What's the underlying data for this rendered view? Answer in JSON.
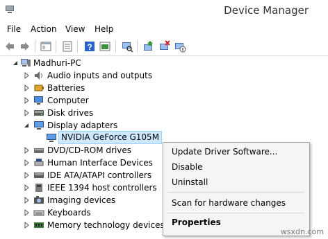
{
  "window": {
    "title": "Device Manager"
  },
  "menubar": {
    "items": [
      "File",
      "Action",
      "View",
      "Help"
    ]
  },
  "toolbar": {
    "buttons": [
      "back-icon",
      "forward-icon",
      "properties-pane-icon",
      "update-icon",
      "help-icon",
      "show-hidden-icon",
      "scan-icon",
      "update-driver-icon",
      "uninstall-icon",
      "disable-icon"
    ]
  },
  "tree": {
    "root": "Madhuri-PC",
    "nodes": [
      {
        "label": "Audio inputs and outputs",
        "icon": "speaker-icon"
      },
      {
        "label": "Batteries",
        "icon": "battery-icon"
      },
      {
        "label": "Computer",
        "icon": "computer-icon"
      },
      {
        "label": "Disk drives",
        "icon": "disk-icon"
      },
      {
        "label": "Display adapters",
        "icon": "display-icon",
        "expanded": true
      },
      {
        "label": "NVIDIA GeForce G105M",
        "icon": "display-icon",
        "child": true,
        "selected": true
      },
      {
        "label": "DVD/CD-ROM drives",
        "icon": "dvd-icon"
      },
      {
        "label": "Human Interface Devices",
        "icon": "hid-icon"
      },
      {
        "label": "IDE ATA/ATAPI controllers",
        "icon": "ide-icon"
      },
      {
        "label": "IEEE 1394 host controllers",
        "icon": "ieee-icon"
      },
      {
        "label": "Imaging devices",
        "icon": "camera-icon"
      },
      {
        "label": "Keyboards",
        "icon": "keyboard-icon"
      },
      {
        "label": "Memory technology devices",
        "icon": "memory-icon"
      }
    ]
  },
  "context_menu": {
    "items": [
      {
        "label": "Update Driver Software..."
      },
      {
        "label": "Disable"
      },
      {
        "label": "Uninstall"
      },
      {
        "label": "Scan for hardware changes"
      },
      {
        "label": "Properties",
        "bold": true
      }
    ]
  },
  "watermark": "wsxdn.com"
}
